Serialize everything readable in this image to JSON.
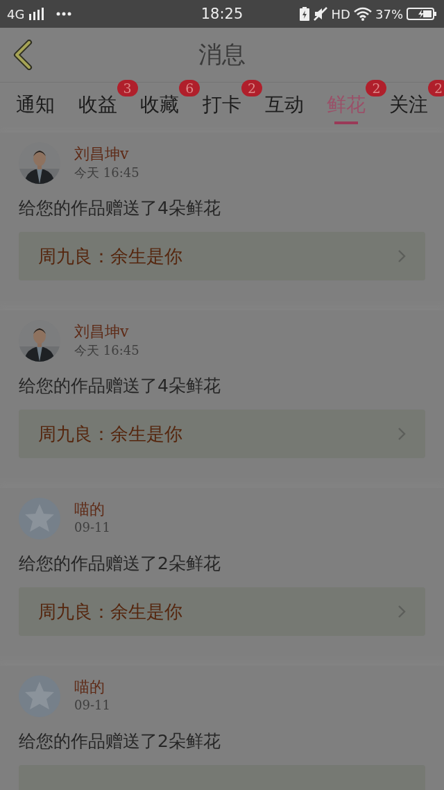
{
  "status_bar": {
    "network": "4G",
    "time": "18:25",
    "hd": "HD",
    "battery": "37%"
  },
  "header": {
    "title": "消息"
  },
  "tabs": [
    {
      "label": "通知",
      "selected": false
    },
    {
      "label": "收益",
      "selected": false,
      "badge": "3"
    },
    {
      "label": "收藏",
      "selected": false,
      "badge": "6"
    },
    {
      "label": "打卡",
      "selected": false,
      "badge": "2"
    },
    {
      "label": "互动",
      "selected": false
    },
    {
      "label": "鲜花",
      "selected": true,
      "badge": "2"
    },
    {
      "label": "关注",
      "selected": false,
      "badge": "2"
    }
  ],
  "messages": [
    {
      "name": "刘昌坤v",
      "time": "今天  16:45",
      "text": "给您的作品赠送了4朵鲜花",
      "work": {
        "kind": "link",
        "title": "周九良：余生是你"
      }
    },
    {
      "name": "刘昌坤v",
      "time": "今天  16:45",
      "text": "给您的作品赠送了4朵鲜花",
      "work": {
        "kind": "link",
        "title": "周九良：余生是你"
      }
    },
    {
      "avatar": {
        "kind": "default"
      },
      "name": "喵的",
      "time": "09-11",
      "text": "给您的作品赠送了2朵鲜花",
      "work": {
        "kind": "link",
        "title": "周九良：余生是你"
      }
    },
    {
      "avatar": {
        "kind": "default"
      },
      "name": "喵的",
      "time": "09-11",
      "text": "给您的作品赠送了2朵鲜花",
      "work": {
        "kind": "link"
      }
    }
  ]
}
